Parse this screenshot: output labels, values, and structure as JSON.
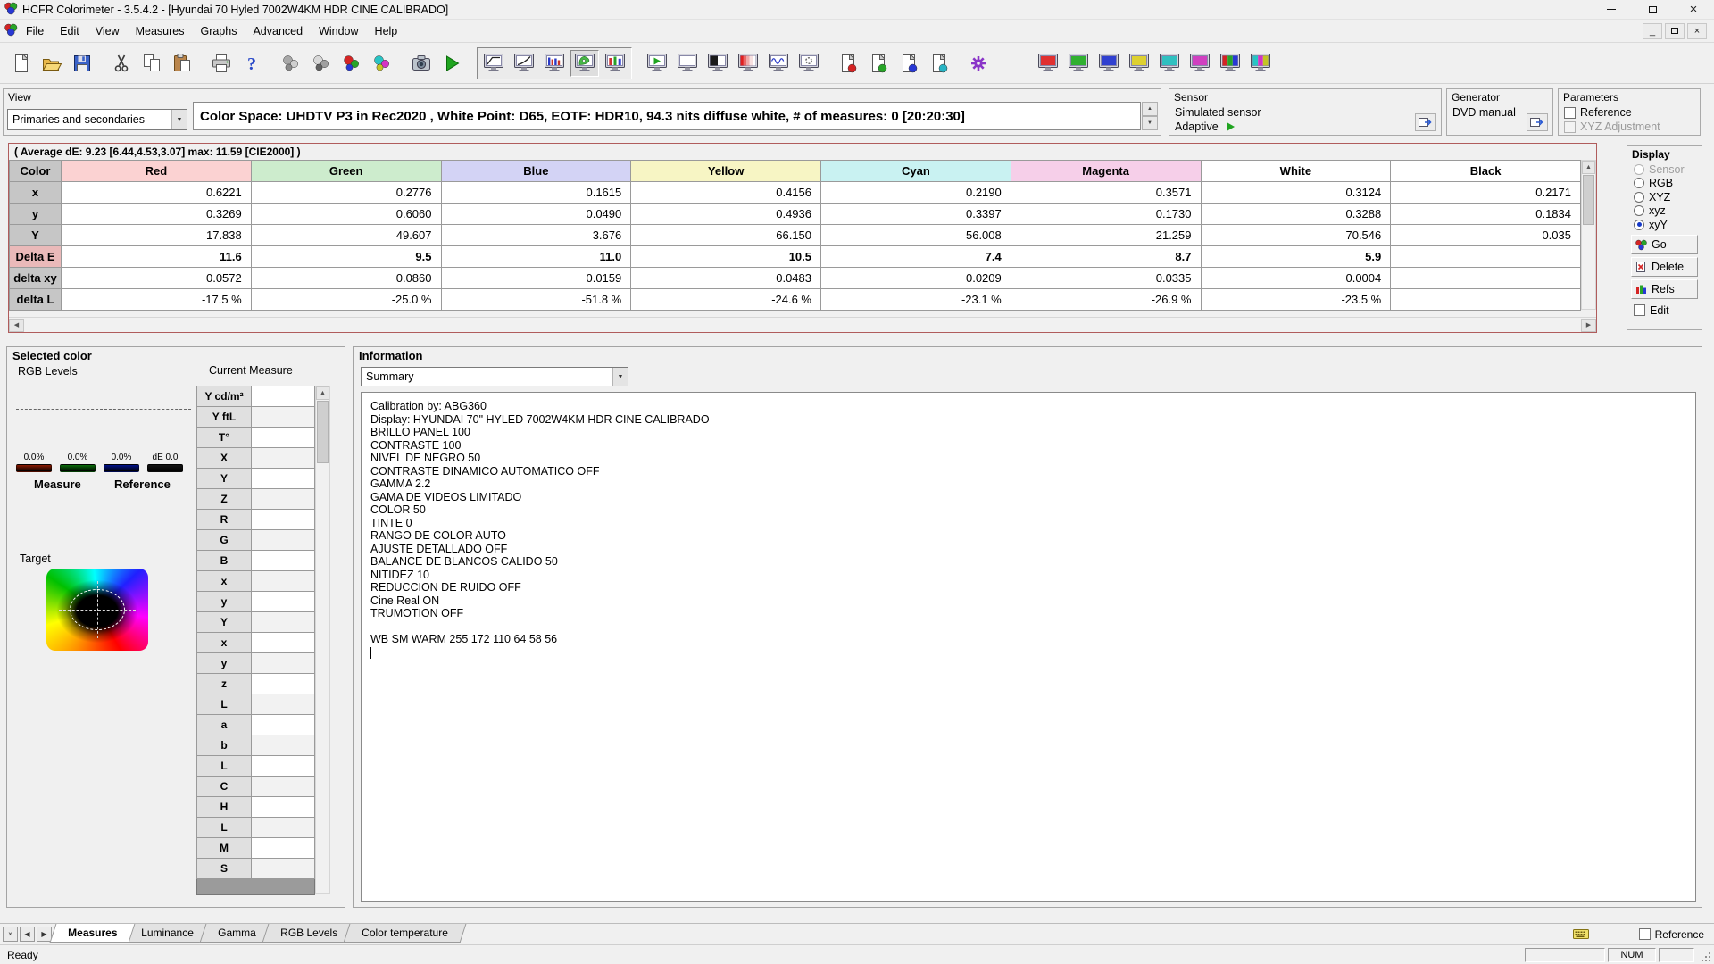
{
  "window": {
    "title": "HCFR Colorimeter - 3.5.4.2 - [Hyundai 70 Hyled 7002W4KM HDR CINE CALIBRADO]"
  },
  "menu": [
    "File",
    "Edit",
    "View",
    "Measures",
    "Graphs",
    "Advanced",
    "Window",
    "Help"
  ],
  "toolbar": {
    "groups": [
      {
        "style": "plain",
        "icons": [
          "new-file",
          "open-file",
          "save-file"
        ]
      },
      {
        "style": "plain",
        "icons": [
          "cut",
          "copy",
          "paste"
        ]
      },
      {
        "style": "plain",
        "icons": [
          "print",
          "help"
        ]
      },
      {
        "style": "plain",
        "icons": [
          "free-measure",
          "grayscale-measure",
          "primaries-measure",
          "secondaries-measure"
        ]
      },
      {
        "style": "plain",
        "icons": [
          "capture",
          "run-measures"
        ]
      },
      {
        "style": "sunken",
        "active": "view-cie",
        "icons": [
          "view-luminance",
          "view-gamma",
          "view-temperature",
          "view-cie",
          "view-rgb-levels"
        ]
      },
      {
        "style": "plain",
        "icons": [
          "meas-continuous",
          "meas-free",
          "meas-contrast",
          "meas-saturation",
          "meas-wave",
          "meas-config"
        ]
      },
      {
        "style": "plain",
        "icons": [
          "chart-red",
          "chart-green",
          "chart-blue",
          "chart-cyan"
        ]
      },
      {
        "style": "plain",
        "icons": [
          "settings"
        ]
      },
      {
        "style": "plain",
        "icons": [
          "sat-red",
          "sat-green",
          "sat-blue",
          "sat-yellow",
          "sat-cyan",
          "sat-magenta",
          "sat-primaries",
          "sat-secondaries"
        ]
      }
    ]
  },
  "view_panel": {
    "title": "View",
    "dropdown_value": "Primaries and secondaries"
  },
  "info_bar": {
    "text": "Color Space: UHDTV P3 in Rec2020 , White Point: D65, EOTF:  HDR10, 94.3 nits diffuse white, # of measures: 0 [20:20:30]"
  },
  "sensor_panel": {
    "title": "Sensor",
    "line1": "Simulated sensor",
    "line2": "Adaptive"
  },
  "generator_panel": {
    "title": "Generator",
    "value": "DVD manual"
  },
  "parameters_panel": {
    "title": "Parameters",
    "options": [
      {
        "label": "Reference",
        "checked": false,
        "disabled": false
      },
      {
        "label": "XYZ Adjustment",
        "checked": false,
        "disabled": true
      }
    ]
  },
  "measures_table": {
    "summary": "( Average dE: 9.23 [6.44,4.53,3.07] max: 11.59 [CIE2000] )",
    "columns": [
      "Color",
      "Red",
      "Green",
      "Blue",
      "Yellow",
      "Cyan",
      "Magenta",
      "White",
      "Black"
    ],
    "column_colors": [
      "#c6c6c6",
      "#fbd2d2",
      "#cdeccd",
      "#d3d3f5",
      "#f7f5c4",
      "#c9f2f2",
      "#f6cfe9",
      "#ffffff",
      "#ffffff"
    ],
    "rows": [
      {
        "label": "x",
        "values": [
          "0.6221",
          "0.2776",
          "0.1615",
          "0.4156",
          "0.2190",
          "0.3571",
          "0.3124",
          "0.2171"
        ]
      },
      {
        "label": "y",
        "values": [
          "0.3269",
          "0.6060",
          "0.0490",
          "0.4936",
          "0.3397",
          "0.1730",
          "0.3288",
          "0.1834"
        ]
      },
      {
        "label": "Y",
        "values": [
          "17.838",
          "49.607",
          "3.676",
          "66.150",
          "56.008",
          "21.259",
          "70.546",
          "0.035"
        ]
      },
      {
        "label": "Delta E",
        "values": [
          "11.6",
          "9.5",
          "11.0",
          "10.5",
          "7.4",
          "8.7",
          "5.9",
          ""
        ],
        "highlight": true
      },
      {
        "label": "delta xy",
        "values": [
          "0.0572",
          "0.0860",
          "0.0159",
          "0.0483",
          "0.0209",
          "0.0335",
          "0.0004",
          ""
        ]
      },
      {
        "label": "delta L",
        "values": [
          "-17.5 %",
          "-25.0 %",
          "-51.8 %",
          "-24.6 %",
          "-23.1 %",
          "-26.9 %",
          "-23.5 %",
          ""
        ],
        "shade": true
      }
    ]
  },
  "display_panel": {
    "title": "Display",
    "radios": [
      {
        "label": "Sensor",
        "disabled": true
      },
      {
        "label": "RGB"
      },
      {
        "label": "XYZ"
      },
      {
        "label": "xyz"
      },
      {
        "label": "xyY",
        "selected": true
      }
    ],
    "go_label": "Go",
    "delete_label": "Delete",
    "refs_label": "Refs",
    "edit_label": "Edit"
  },
  "selected_color": {
    "title": "Selected color",
    "rgb_levels_label": "RGB Levels",
    "current_measure_label": "Current Measure",
    "bars": [
      {
        "label": "0.0%",
        "color": "#8c1a00"
      },
      {
        "label": "0.0%",
        "color": "#0a6e0a"
      },
      {
        "label": "0.0%",
        "color": "#00128c"
      },
      {
        "label": "dE 0.0",
        "color": "#141414"
      }
    ],
    "measure_label": "Measure",
    "reference_label": "Reference",
    "target_label": "Target",
    "measure_rows": [
      "Y cd/m²",
      "Y ftL",
      "T°",
      "X",
      "Y",
      "Z",
      "R",
      "G",
      "B",
      "x",
      "y",
      "Y",
      "x",
      "y",
      "z",
      "L",
      "a",
      "b",
      "L",
      "C",
      "H",
      "L",
      "M",
      "S"
    ]
  },
  "information": {
    "title": "Information",
    "dropdown_value": "Summary",
    "lines": [
      "Calibration by: ABG360",
      "Display: HYUNDAI 70\" HYLED 7002W4KM HDR CINE CALIBRADO",
      "BRILLO PANEL 100",
      "CONTRASTE 100",
      "NIVEL DE NEGRO 50",
      "CONTRASTE DINAMICO AUTOMATICO OFF",
      "GAMMA 2.2",
      "GAMA DE VIDEOS LIMITADO",
      "COLOR 50",
      "TINTE 0",
      "RANGO DE COLOR AUTO",
      "AJUSTE DETALLADO OFF",
      "BALANCE DE BLANCOS CALIDO 50",
      "NITIDEZ 10",
      "REDUCCION DE RUIDO OFF",
      "Cine Real ON",
      "TRUMOTION OFF",
      "",
      "WB SM WARM 255 172 110 64 58 56"
    ]
  },
  "bottom_tabs": {
    "tabs": [
      "Measures",
      "Luminance",
      "Gamma",
      "RGB Levels",
      "Color temperature"
    ],
    "active": "Measures"
  },
  "status_bar": {
    "status": "Ready",
    "num": "NUM",
    "reference_label": "Reference"
  }
}
